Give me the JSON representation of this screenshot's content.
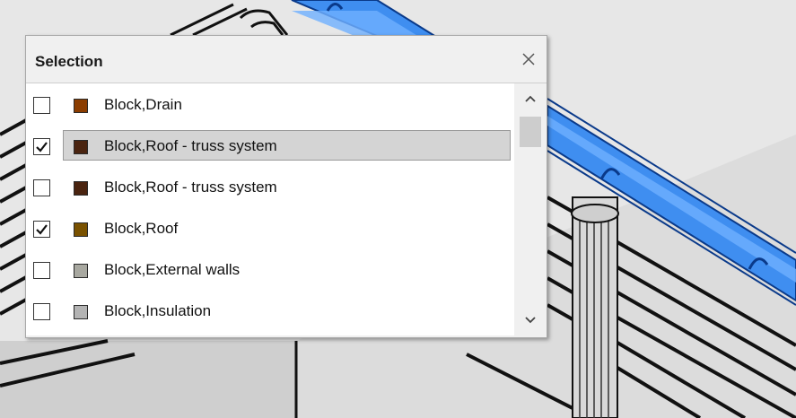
{
  "dialog": {
    "title": "Selection",
    "close_icon": "close-icon"
  },
  "items": [
    {
      "label": "Block,Drain",
      "checked": false,
      "selected": false,
      "color": "#8b3d00"
    },
    {
      "label": "Block,Roof - truss system",
      "checked": true,
      "selected": true,
      "color": "#4a2410"
    },
    {
      "label": "Block,Roof - truss system",
      "checked": false,
      "selected": false,
      "color": "#4a2410"
    },
    {
      "label": "Block,Roof",
      "checked": true,
      "selected": false,
      "color": "#7a5200"
    },
    {
      "label": "Block,External walls",
      "checked": false,
      "selected": false,
      "color": "#a8a8a0"
    },
    {
      "label": "Block,Insulation",
      "checked": false,
      "selected": false,
      "color": "#b4b4b4"
    }
  ],
  "scrollbar": {
    "up_icon": "chevron-up-icon",
    "down_icon": "chevron-down-icon"
  },
  "colors": {
    "rail_blue": "#3f8ef0",
    "selection_highlight": "#d4d4d4"
  }
}
